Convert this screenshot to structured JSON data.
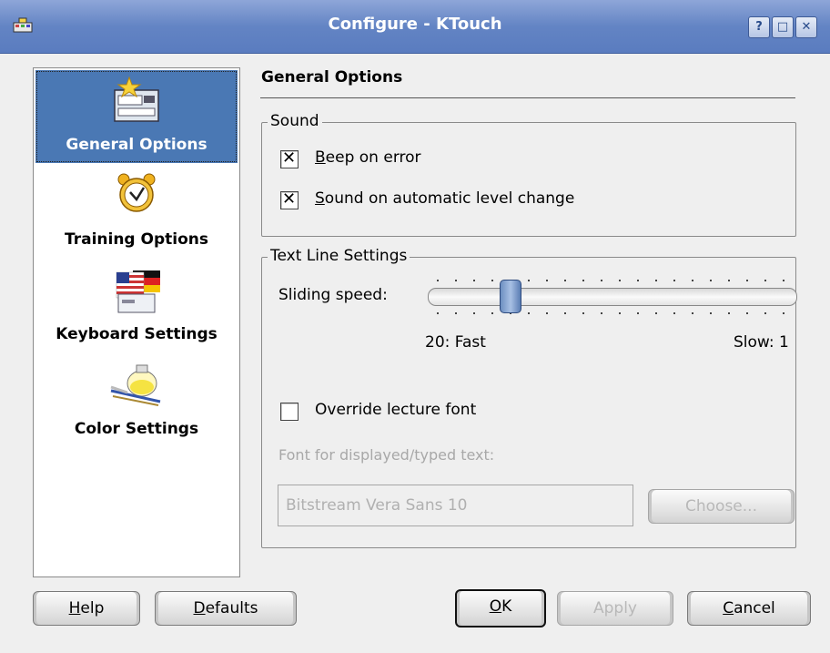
{
  "window": {
    "title": "Configure - KTouch",
    "buttons": {
      "help": "?",
      "maximize": "□",
      "close": "✕"
    }
  },
  "sidebar": {
    "items": [
      {
        "label": "General Options",
        "icon": "general-options-icon",
        "selected": true
      },
      {
        "label": "Training Options",
        "icon": "alarm-clock-icon",
        "selected": false
      },
      {
        "label": "Keyboard Settings",
        "icon": "flags-keyboard-icon",
        "selected": false
      },
      {
        "label": "Color Settings",
        "icon": "paint-palette-icon",
        "selected": false
      }
    ]
  },
  "page": {
    "title": "General Options",
    "sound": {
      "legend": "Sound",
      "beep_on_error": {
        "label": "Beep on error",
        "accel": "B",
        "rest": "eep on error",
        "checked": true
      },
      "sound_level_change": {
        "label": "Sound on automatic level change",
        "accel": "S",
        "rest": "ound on automatic level change",
        "checked": true
      }
    },
    "text_line": {
      "legend": "Text Line Settings",
      "sliding_speed_label": "Sliding speed:",
      "slider_value_fraction": 0.2,
      "fast_label": "20: Fast",
      "slow_label": "Slow: 1",
      "override_font": {
        "label": "Override lecture font",
        "checked": false
      },
      "font_label": "Font for displayed/typed text:",
      "font_value": "Bitstream Vera Sans 10",
      "choose_button": "Choose..."
    }
  },
  "buttons": {
    "help": {
      "accel": "H",
      "rest": "elp"
    },
    "defaults": {
      "accel": "D",
      "rest": "efaults"
    },
    "ok": {
      "accel": "O",
      "rest": "K"
    },
    "apply": {
      "label": "Apply"
    },
    "cancel": {
      "accel": "C",
      "rest": "ancel"
    }
  }
}
